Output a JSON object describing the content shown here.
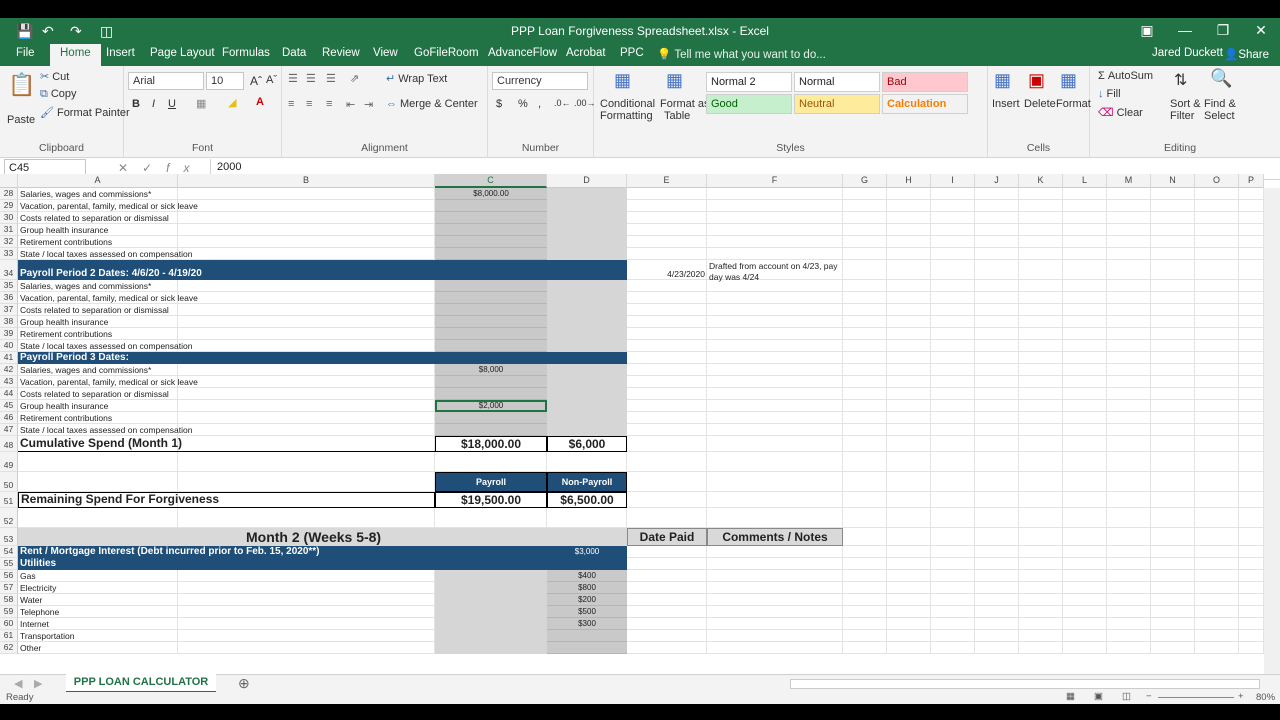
{
  "title": "PPP Loan Forgiveness Spreadsheet.xlsx - Excel",
  "tabs": [
    "File",
    "Home",
    "Insert",
    "Page Layout",
    "Formulas",
    "Data",
    "Review",
    "View",
    "GoFileRoom",
    "AdvanceFlow",
    "Acrobat",
    "PPC"
  ],
  "tell": "Tell me what you want to do...",
  "user": "Jared Duckett",
  "share": "Share",
  "ribbon": {
    "paste": "Paste",
    "cut": "Cut",
    "copy": "Copy",
    "format_painter": "Format Painter",
    "clipboard": "Clipboard",
    "font_name": "Arial",
    "font_size": "10",
    "font": "Font",
    "wrap": "Wrap Text",
    "merge": "Merge & Center",
    "alignment": "Alignment",
    "numfmt": "Currency",
    "number": "Number",
    "cond1": "Conditional",
    "cond2": "Formatting",
    "fat1": "Format as",
    "fat2": "Table",
    "styles": [
      "Normal 2",
      "Normal",
      "Bad",
      "Good",
      "Neutral",
      "Calculation"
    ],
    "styles_label": "Styles",
    "insert": "Insert",
    "delete": "Delete",
    "format": "Format",
    "cells": "Cells",
    "autosum": "AutoSum",
    "fill": "Fill",
    "clear": "Clear",
    "sort1": "Sort &",
    "sort2": "Filter",
    "find1": "Find &",
    "find2": "Select",
    "editing": "Editing"
  },
  "namebox": "C45",
  "formula": "2000",
  "cols": [
    "A",
    "B",
    "C",
    "D",
    "E",
    "F",
    "G",
    "H",
    "I",
    "J",
    "K",
    "L",
    "M",
    "N",
    "O",
    "P"
  ],
  "rows": [
    {
      "n": "28",
      "a": "Salaries, wages and commissions*",
      "c": "$8,000.00"
    },
    {
      "n": "29",
      "a": "Vacation, parental, family, medical or sick leave"
    },
    {
      "n": "30",
      "a": "Costs related to separation or dismissal"
    },
    {
      "n": "31",
      "a": "Group health insurance"
    },
    {
      "n": "32",
      "a": "Retirement contributions"
    },
    {
      "n": "33",
      "a": "State / local taxes assessed on compensation"
    },
    {
      "n": "34",
      "a": "Payroll Period 2     Dates: 4/6/20 - 4/19/20",
      "e": "4/23/2020",
      "f": "Drafted from account on 4/23, pay",
      "f2": "day was 4/24"
    },
    {
      "n": "35",
      "a": "Salaries, wages and commissions*"
    },
    {
      "n": "36",
      "a": "Vacation, parental, family, medical or sick leave"
    },
    {
      "n": "37",
      "a": "Costs related to separation or dismissal"
    },
    {
      "n": "38",
      "a": "Group health insurance"
    },
    {
      "n": "39",
      "a": "Retirement contributions"
    },
    {
      "n": "40",
      "a": "State / local taxes assessed on compensation"
    },
    {
      "n": "41",
      "a": "Payroll Period 3     Dates:"
    },
    {
      "n": "42",
      "a": "Salaries, wages and commissions*",
      "c": "$8,000"
    },
    {
      "n": "43",
      "a": "Vacation, parental, family, medical or sick leave"
    },
    {
      "n": "44",
      "a": "Costs related to separation or dismissal"
    },
    {
      "n": "45",
      "a": "Group health insurance",
      "c": "$2,000"
    },
    {
      "n": "46",
      "a": "Retirement contributions"
    },
    {
      "n": "47",
      "a": "State / local taxes assessed on compensation"
    },
    {
      "n": "48",
      "a": "Cumulative Spend (Month 1)",
      "c": "$18,000.00",
      "d": "$6,000"
    },
    {
      "n": "49"
    },
    {
      "n": "50",
      "c": "Payroll",
      "d": "Non-Payroll"
    },
    {
      "n": "51",
      "a": "Remaining Spend For Forgiveness",
      "c": "$19,500.00",
      "d": "$6,500.00"
    },
    {
      "n": "52"
    },
    {
      "n": "53",
      "a": "Month 2 (Weeks 5-8)",
      "e": "Date Paid",
      "f": "Comments / Notes"
    },
    {
      "n": "54",
      "a": "Rent / Mortgage Interest (Debt incurred prior to Feb. 15, 2020**)",
      "d": "$3,000"
    },
    {
      "n": "55",
      "a": "Utilities"
    },
    {
      "n": "56",
      "a": "Gas",
      "d": "$400"
    },
    {
      "n": "57",
      "a": "Electricity",
      "d": "$800"
    },
    {
      "n": "58",
      "a": "Water",
      "d": "$200"
    },
    {
      "n": "59",
      "a": "Telephone",
      "d": "$500"
    },
    {
      "n": "60",
      "a": "Internet",
      "d": "$300"
    },
    {
      "n": "61",
      "a": "Transportation"
    },
    {
      "n": "62",
      "a": "Other"
    }
  ],
  "sheet": "PPP LOAN CALCULATOR",
  "status": "Ready",
  "zoom": "80%"
}
